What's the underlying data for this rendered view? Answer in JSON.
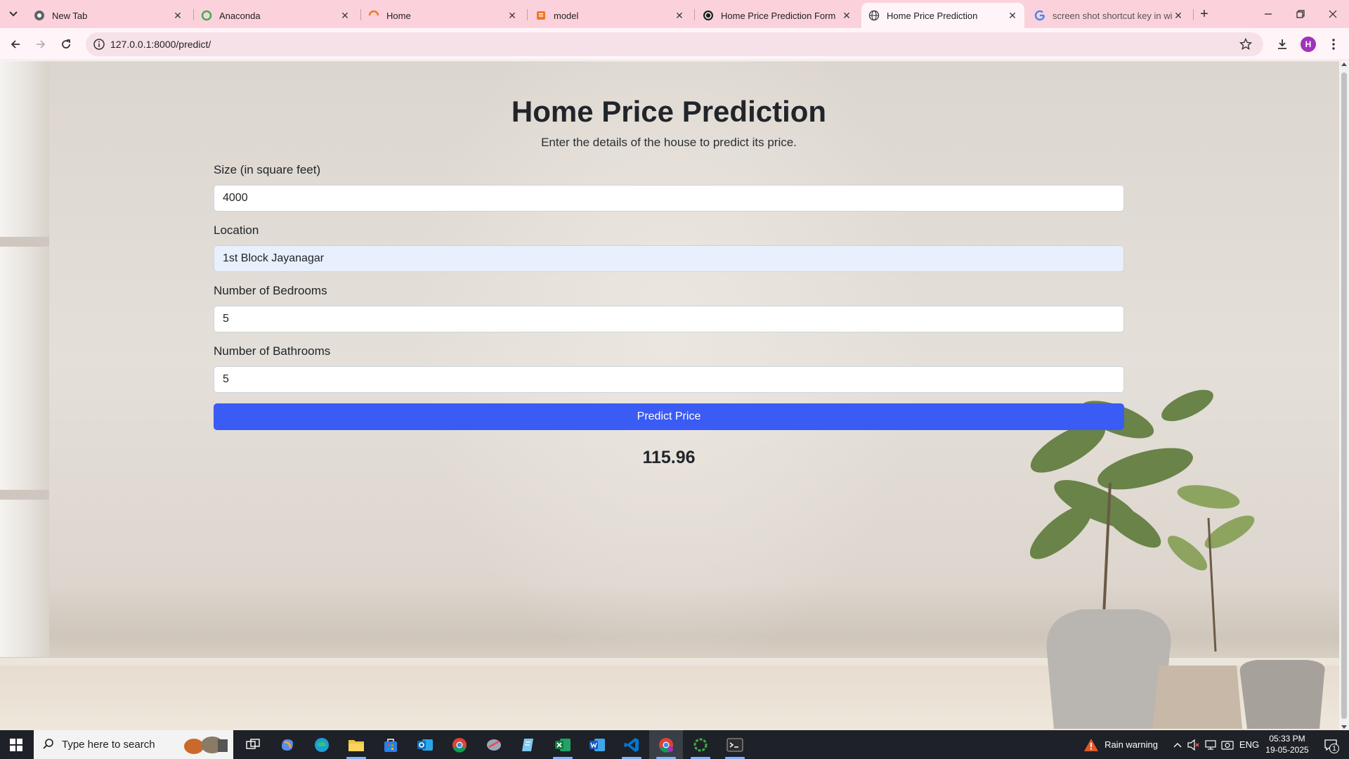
{
  "browser": {
    "tabs": [
      {
        "title": "New Tab",
        "icon": "chrome-icon",
        "active": false
      },
      {
        "title": "Anaconda",
        "icon": "anaconda-icon",
        "active": false
      },
      {
        "title": "Home",
        "icon": "loading-icon",
        "active": false
      },
      {
        "title": "model",
        "icon": "notebook-icon",
        "active": false
      },
      {
        "title": "Home Price Prediction Form",
        "icon": "openai-icon",
        "active": false
      },
      {
        "title": "Home Price Prediction",
        "icon": "globe-icon",
        "active": true
      },
      {
        "title": "screen shot shortcut key in win",
        "icon": "google-icon",
        "active": false
      }
    ],
    "url": "127.0.0.1:8000/predict/",
    "profile_initial": "H"
  },
  "page": {
    "title": "Home Price Prediction",
    "subtitle": "Enter the details of the house to predict its price.",
    "fields": [
      {
        "label": "Size (in square feet)",
        "value": "4000"
      },
      {
        "label": "Location",
        "value": "1st Block Jayanagar"
      },
      {
        "label": "Number of Bedrooms",
        "value": "5"
      },
      {
        "label": "Number of Bathrooms",
        "value": "5"
      }
    ],
    "button_label": "Predict Price",
    "result": "115.96"
  },
  "taskbar": {
    "search_placeholder": "Type here to search",
    "weather": "Rain warning",
    "language": "ENG",
    "time": "05:33 PM",
    "date": "19-05-2025",
    "notification_count": "1"
  },
  "colors": {
    "tab_strip": "#fbd2dc",
    "toolbar": "#fff5f8",
    "button": "#3b5bf5",
    "autofill": "#e8f0fe"
  }
}
